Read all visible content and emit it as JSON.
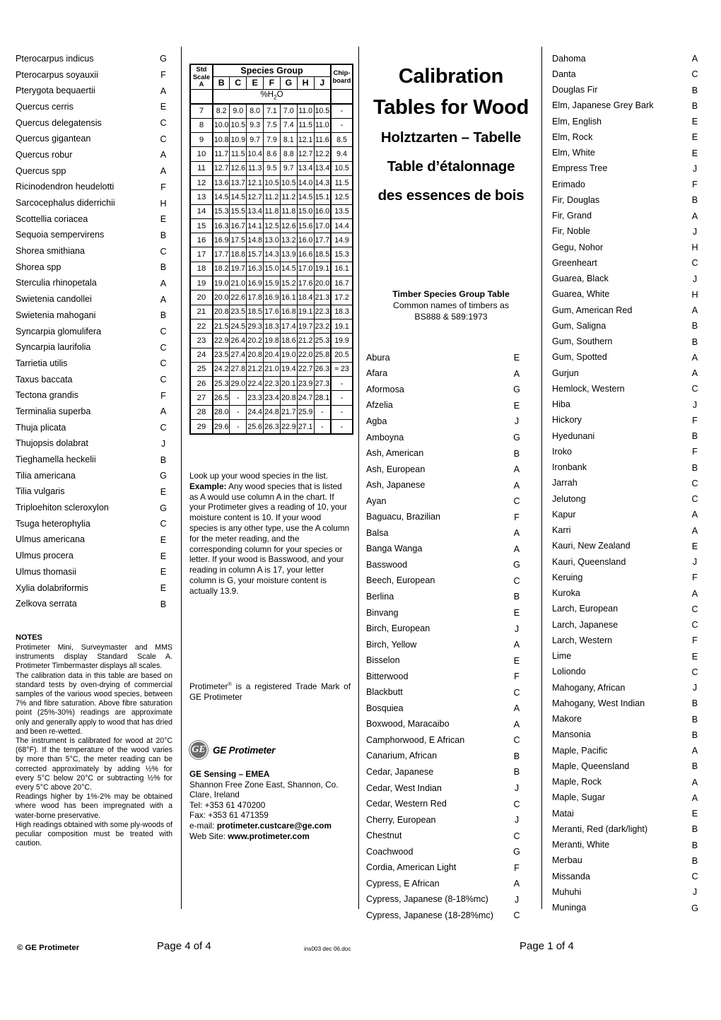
{
  "title": {
    "line1": "Calibration",
    "line2": "Tables for Wood",
    "line3": "Holztzarten – Tabelle",
    "line4": "Table d’étalonnage",
    "line5": "des essences de bois"
  },
  "subtitle": {
    "line1": "Timber Species Group Table",
    "line2": "Common names of timbers as",
    "line3": "BS888 & 589:1973"
  },
  "chart": {
    "header_scale": "Std Scale A",
    "header_scale_l1": "Std",
    "header_scale_l2": "Scale",
    "header_scale_l3": "A",
    "header_group": "Species Group",
    "header_chip_l1": "Chip-",
    "header_chip_l2": "board",
    "columns": [
      "B",
      "C",
      "E",
      "F",
      "G",
      "H",
      "J"
    ],
    "units_label": "%H2O",
    "rows": [
      {
        "scale": "7",
        "values": [
          "8.2",
          "9.0",
          "8.0",
          "7.1",
          "7.0",
          "11.0",
          "10.5"
        ],
        "chip": "-"
      },
      {
        "scale": "8",
        "values": [
          "10.0",
          "10.5",
          "9.3",
          "7.5",
          "7.4",
          "11.5",
          "11.0"
        ],
        "chip": "-"
      },
      {
        "scale": "9",
        "values": [
          "10.8",
          "10.9",
          "9.7",
          "7.9",
          "8.1",
          "12.1",
          "11.6"
        ],
        "chip": "8.5"
      },
      {
        "scale": "10",
        "values": [
          "11.7",
          "11.5",
          "10.4",
          "8.6",
          "8.8",
          "12.7",
          "12.2"
        ],
        "chip": "9.4"
      },
      {
        "scale": "11",
        "values": [
          "12.7",
          "12.6",
          "11.3",
          "9.5",
          "9.7",
          "13.4",
          "13.4"
        ],
        "chip": "10.5"
      },
      {
        "scale": "12",
        "values": [
          "13.6",
          "13.7",
          "12.1",
          "10.5",
          "10.5",
          "14.0",
          "14.3"
        ],
        "chip": "11.5"
      },
      {
        "scale": "13",
        "values": [
          "14.5",
          "14.5",
          "12.7",
          "11.2",
          "11.2",
          "14.5",
          "15.1"
        ],
        "chip": "12.5"
      },
      {
        "scale": "14",
        "values": [
          "15.3",
          "15.5",
          "13.4",
          "11.8",
          "11.8",
          "15.0",
          "16.0"
        ],
        "chip": "13.5"
      },
      {
        "scale": "15",
        "values": [
          "16.3",
          "16.7",
          "14.1",
          "12.5",
          "12.6",
          "15.6",
          "17.0"
        ],
        "chip": "14.4"
      },
      {
        "scale": "16",
        "values": [
          "16.9",
          "17.5",
          "14.8",
          "13.0",
          "13.2",
          "16.0",
          "17.7"
        ],
        "chip": "14.9"
      },
      {
        "scale": "17",
        "values": [
          "17.7",
          "18.8",
          "15.7",
          "14.3",
          "13.9",
          "16.6",
          "18.5"
        ],
        "chip": "15.3"
      },
      {
        "scale": "18",
        "values": [
          "18.2",
          "19.7",
          "16.3",
          "15.0",
          "14.5",
          "17.0",
          "19.1"
        ],
        "chip": "16.1"
      },
      {
        "scale": "19",
        "values": [
          "19.0",
          "21.0",
          "16.9",
          "15.9",
          "15.2",
          "17.6",
          "20.0"
        ],
        "chip": "16.7"
      },
      {
        "scale": "20",
        "values": [
          "20.0",
          "22.6",
          "17.8",
          "16.9",
          "16.1",
          "18.4",
          "21.3"
        ],
        "chip": "17.2"
      },
      {
        "scale": "21",
        "values": [
          "20.8",
          "23.5",
          "18.5",
          "17.6",
          "16.8",
          "19.1",
          "22.3"
        ],
        "chip": "18.3"
      },
      {
        "scale": "22",
        "values": [
          "21.5",
          "24.5",
          "29.3",
          "18.3",
          "17.4",
          "19.7",
          "23.2"
        ],
        "chip": "19.1"
      },
      {
        "scale": "23",
        "values": [
          "22.9",
          "26.4",
          "20.2",
          "19.8",
          "18.6",
          "21.2",
          "25.3"
        ],
        "chip": "19.9"
      },
      {
        "scale": "24",
        "values": [
          "23.5",
          "27.4",
          "20.8",
          "20.4",
          "19.0",
          "22.0",
          "25.8"
        ],
        "chip": "20.5"
      },
      {
        "scale": "25",
        "values": [
          "24.2",
          "27.8",
          "21.2",
          "21.0",
          "19.4",
          "22.7",
          "26.3"
        ],
        "chip": "≈ 23"
      },
      {
        "scale": "26",
        "values": [
          "25.3",
          "29.0",
          "22.4",
          "22.3",
          "20.1",
          "23.9",
          "27.3"
        ],
        "chip": "-"
      },
      {
        "scale": "27",
        "values": [
          "26.5",
          "-",
          "23.3",
          "23.4",
          "20.8",
          "24.7",
          "28.1"
        ],
        "chip": "-"
      },
      {
        "scale": "28",
        "values": [
          "28.0",
          "-",
          "24.4",
          "24.8",
          "21.7",
          "25.9",
          "-"
        ],
        "chip": "-"
      },
      {
        "scale": "29",
        "values": [
          "29.6",
          "-",
          "25.6",
          "26.3",
          "22.9",
          "27.1",
          "-"
        ],
        "chip": "-"
      }
    ]
  },
  "instructions": {
    "lead": "Look up your wood species in the list. ",
    "example_label": "Example:",
    "body": " Any wood species that is listed as A would use column A in the chart. If your Protimeter gives a reading of 10, your moisture content is 10. If your wood species is any other type, use the A column for the meter reading, and the corresponding column for your species or letter. If your wood is Basswood, and your reading in column A is 17, your letter column is G,  your moisture content is actually 13.9."
  },
  "trademark": {
    "pre": "Protimeter",
    "sup": "®",
    "post": " is a registered Trade Mark of GE Protimeter"
  },
  "logo": {
    "mark_text": "GE",
    "wordmark": "GE Protimeter"
  },
  "address": {
    "company": "GE Sensing – EMEA",
    "street": "Shannon Free Zone East, Shannon, Co. Clare, Ireland",
    "tel": "Tel: +353 61 470200",
    "fax": "Fax: +353 61 471359",
    "email_label": "e-mail: ",
    "email": "protimeter.custcare@ge.com",
    "web_label": "Web Site: ",
    "web": "www.protimeter.com"
  },
  "notes": {
    "title": "NOTES",
    "p1": "Protimeter Mini, Surveymaster and MMS instruments display Standard Scale A. Protimeter Timbermaster displays all scales.",
    "p2": "The calibration data in this table are based on standard tests by oven-drying of commercial samples of the various wood species, between 7% and fibre saturation. Above fibre saturation point (25%-30%) readings are approximate only and generally apply to wood that has dried and been re-wetted.",
    "p3": "The instrument is calibrated for wood at 20°C (68°F). If the temperature of the wood varies by more than 5°C, the meter reading can be corrected approximately by adding ½% for every 5°C below 20°C or subtracting ½% for every 5°C above 20°C.",
    "p4": "Readings higher by 1%-2% may be obtained where wood has been impregnated with a water-borne preservative.",
    "p5": "High readings obtained with some ply-woods of peculiar composition must be treated with caution."
  },
  "col1_species": [
    {
      "name": "Pterocarpus indicus",
      "group": "G"
    },
    {
      "name": "Pterocarpus soyauxii",
      "group": "F"
    },
    {
      "name": "Pterygota bequaertii",
      "group": "A"
    },
    {
      "name": "Quercus cerris",
      "group": "E"
    },
    {
      "name": "Quercus delegatensis",
      "group": "C"
    },
    {
      "name": "Quercus gigantean",
      "group": "C"
    },
    {
      "name": "Quercus robur",
      "group": "A"
    },
    {
      "name": "Quercus spp",
      "group": "A"
    },
    {
      "name": "Ricinodendron heudelotti",
      "group": "F"
    },
    {
      "name": "Sarcocephalus diderrichii",
      "group": "H"
    },
    {
      "name": "Scottellia coriacea",
      "group": "E"
    },
    {
      "name": "Sequoia sempervirens",
      "group": "B"
    },
    {
      "name": "Shorea smithiana",
      "group": "C"
    },
    {
      "name": "Shorea spp",
      "group": "B"
    },
    {
      "name": "Sterculia rhinopetala",
      "group": "A"
    },
    {
      "name": "Swietenia candollei",
      "group": "A"
    },
    {
      "name": "Swietenia mahogani",
      "group": "B"
    },
    {
      "name": "Syncarpia glomulifera",
      "group": "C"
    },
    {
      "name": "Syncarpia laurifolia",
      "group": "C"
    },
    {
      "name": "Tarrietia utilis",
      "group": "C"
    },
    {
      "name": "Taxus baccata",
      "group": "C"
    },
    {
      "name": "Tectona grandis",
      "group": "F"
    },
    {
      "name": "Terminalia superba",
      "group": "A"
    },
    {
      "name": "Thuja plicata",
      "group": "C"
    },
    {
      "name": "Thujopsis dolabrat",
      "group": "J"
    },
    {
      "name": "Tieghamella heckelii",
      "group": "B"
    },
    {
      "name": "Tilia americana",
      "group": "G"
    },
    {
      "name": "Tilia vulgaris",
      "group": "E"
    },
    {
      "name": "Triploehiton scleroxylon",
      "group": "G"
    },
    {
      "name": "Tsuga heterophylia",
      "group": "C"
    },
    {
      "name": "Ulmus americana",
      "group": "E"
    },
    {
      "name": "Ulmus procera",
      "group": "E"
    },
    {
      "name": "Ulmus thomasii",
      "group": "E"
    },
    {
      "name": "Xylia dolabriformis",
      "group": "E"
    },
    {
      "name": "Zelkova serrata",
      "group": "B"
    }
  ],
  "col3_species": [
    {
      "name": "Abura",
      "group": "E"
    },
    {
      "name": "Afara",
      "group": "A"
    },
    {
      "name": "Aformosa",
      "group": "G"
    },
    {
      "name": "Afzelia",
      "group": "E"
    },
    {
      "name": "Agba",
      "group": "J"
    },
    {
      "name": "Amboyna",
      "group": "G"
    },
    {
      "name": "Ash, American",
      "group": "B"
    },
    {
      "name": "Ash, European",
      "group": "A"
    },
    {
      "name": "Ash, Japanese",
      "group": "A"
    },
    {
      "name": "Ayan",
      "group": "C"
    },
    {
      "name": "Baguacu, Brazilian",
      "group": "F"
    },
    {
      "name": "Balsa",
      "group": "A"
    },
    {
      "name": "Banga Wanga",
      "group": "A"
    },
    {
      "name": "Basswood",
      "group": "G"
    },
    {
      "name": "Beech, European",
      "group": "C"
    },
    {
      "name": "Berlina",
      "group": "B"
    },
    {
      "name": "Binvang",
      "group": "E"
    },
    {
      "name": "Birch, European",
      "group": "J"
    },
    {
      "name": "Birch, Yellow",
      "group": "A"
    },
    {
      "name": "Bisselon",
      "group": "E"
    },
    {
      "name": "Bitterwood",
      "group": "F"
    },
    {
      "name": "Blackbutt",
      "group": "C"
    },
    {
      "name": "Bosquiea",
      "group": "A"
    },
    {
      "name": "Boxwood, Maracaibo",
      "group": "A"
    },
    {
      "name": "Camphorwood, E African",
      "group": "C"
    },
    {
      "name": "Canarium, African",
      "group": "B"
    },
    {
      "name": "Cedar, Japanese",
      "group": "B"
    },
    {
      "name": "Cedar, West Indian",
      "group": "J"
    },
    {
      "name": "Cedar, Western Red",
      "group": "C"
    },
    {
      "name": "Cherry, European",
      "group": "J"
    },
    {
      "name": "Chestnut",
      "group": "C"
    },
    {
      "name": "Coachwood",
      "group": "G"
    },
    {
      "name": "Cordia, American Light",
      "group": "F"
    },
    {
      "name": "Cypress, E African",
      "group": "A"
    },
    {
      "name": "Cypress, Japanese (8-18%mc)",
      "group": "J"
    },
    {
      "name": "Cypress, Japanese (18-28%mc)",
      "group": "C"
    }
  ],
  "col4_species": [
    {
      "name": "Dahoma",
      "group": "A"
    },
    {
      "name": "Danta",
      "group": "C"
    },
    {
      "name": "Douglas Fir",
      "group": "B"
    },
    {
      "name": "Elm, Japanese Grey Bark",
      "group": "B"
    },
    {
      "name": "Elm, English",
      "group": "E"
    },
    {
      "name": "Elm, Rock",
      "group": "E"
    },
    {
      "name": "Elm, White",
      "group": "E"
    },
    {
      "name": "Empress Tree",
      "group": "J"
    },
    {
      "name": "Erimado",
      "group": "F"
    },
    {
      "name": "Fir, Douglas",
      "group": "B"
    },
    {
      "name": "Fir, Grand",
      "group": "A"
    },
    {
      "name": "Fir, Noble",
      "group": "J"
    },
    {
      "name": "Gegu, Nohor",
      "group": "H"
    },
    {
      "name": "Greenheart",
      "group": "C"
    },
    {
      "name": "Guarea, Black",
      "group": "J"
    },
    {
      "name": "Guarea, White",
      "group": "H"
    },
    {
      "name": "Gum, American Red",
      "group": "A"
    },
    {
      "name": "Gum, Saligna",
      "group": "B"
    },
    {
      "name": "Gum, Southern",
      "group": "B"
    },
    {
      "name": "Gum, Spotted",
      "group": "A"
    },
    {
      "name": "Gurjun",
      "group": "A"
    },
    {
      "name": "Hemlock, Western",
      "group": "C"
    },
    {
      "name": "Hiba",
      "group": "J"
    },
    {
      "name": "Hickory",
      "group": "F"
    },
    {
      "name": "Hyedunani",
      "group": "B"
    },
    {
      "name": "Iroko",
      "group": "F"
    },
    {
      "name": "Ironbank",
      "group": "B"
    },
    {
      "name": "Jarrah",
      "group": "C"
    },
    {
      "name": "Jelutong",
      "group": "C"
    },
    {
      "name": "Kapur",
      "group": "A"
    },
    {
      "name": "Karri",
      "group": "A"
    },
    {
      "name": "Kauri, New Zealand",
      "group": "E"
    },
    {
      "name": "Kauri, Queensland",
      "group": "J"
    },
    {
      "name": "Keruing",
      "group": "F"
    },
    {
      "name": "Kuroka",
      "group": "A"
    },
    {
      "name": "Larch, European",
      "group": "C"
    },
    {
      "name": "Larch, Japanese",
      "group": "C"
    },
    {
      "name": "Larch, Western",
      "group": "F"
    },
    {
      "name": "Lime",
      "group": "E"
    },
    {
      "name": "Loliondo",
      "group": "C"
    },
    {
      "name": "Mahogany, African",
      "group": "J"
    },
    {
      "name": "Mahogany, West Indian",
      "group": "B"
    },
    {
      "name": "Makore",
      "group": "B"
    },
    {
      "name": "Mansonia",
      "group": "B"
    },
    {
      "name": "Maple, Pacific",
      "group": "A"
    },
    {
      "name": "Maple, Queensland",
      "group": "B"
    },
    {
      "name": "Maple, Rock",
      "group": "A"
    },
    {
      "name": "Maple, Sugar",
      "group": "A"
    },
    {
      "name": "Matai",
      "group": "E"
    },
    {
      "name": "Meranti, Red (dark/light)",
      "group": "B"
    },
    {
      "name": "Meranti, White",
      "group": "B"
    },
    {
      "name": "Merbau",
      "group": "B"
    },
    {
      "name": "Missanda",
      "group": "C"
    },
    {
      "name": "Muhuhi",
      "group": "J"
    },
    {
      "name": "Muninga",
      "group": "G"
    }
  ],
  "footer": {
    "copyright": "© GE Protimeter",
    "page_left": "Page 4 of 4",
    "docref": "ins003 dec 06.doc",
    "page_right": "Page 1 of 4"
  }
}
